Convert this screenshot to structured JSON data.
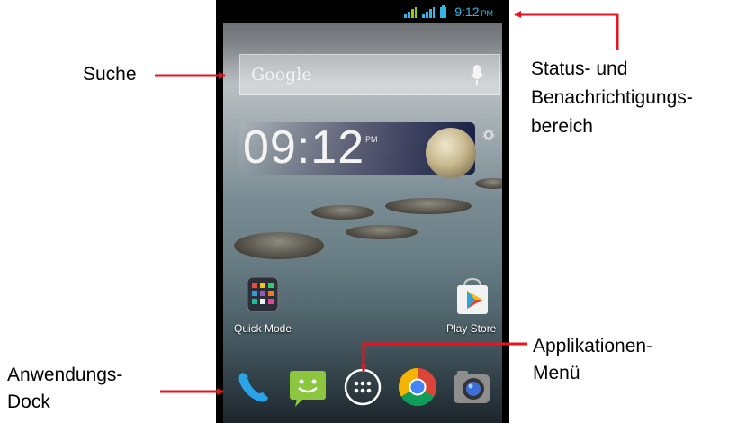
{
  "statusbar": {
    "time": "9:12",
    "ampm": "PM"
  },
  "search": {
    "placeholder": "Google"
  },
  "clock_widget": {
    "time": "09:12",
    "ampm": "PM"
  },
  "apps": {
    "quick_mode": "Quick Mode",
    "play_store": "Play Store"
  },
  "dock": [
    "phone",
    "messaging",
    "app-menu",
    "chrome",
    "camera"
  ],
  "annotations": {
    "suche": "Suche",
    "status_line1": "Status- und",
    "status_line2": "Benachrichtigungs-",
    "status_line3": "bereich",
    "dock_line1": "Anwendungs-",
    "dock_line2": "Dock",
    "menu_line1": "Applikationen-",
    "menu_line2": "Menü"
  },
  "colors": {
    "accent": "#33b5e5",
    "arrow": "#e8141c"
  }
}
